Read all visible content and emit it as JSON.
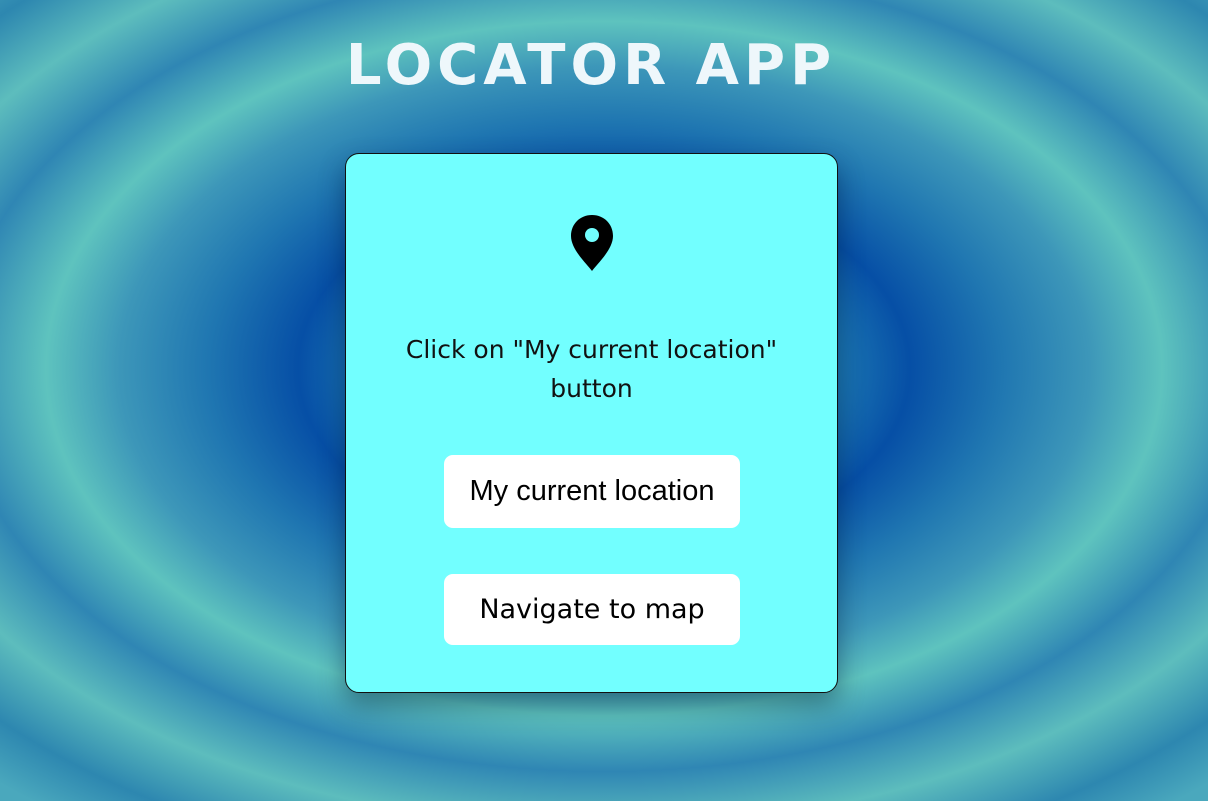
{
  "header": {
    "title": "LOCATOR APP"
  },
  "card": {
    "icon": "location-pin-icon",
    "prompt": "Click on \"My current location\" button",
    "current_location_label": "My current location",
    "navigate_label": "Navigate to map",
    "background_color": "#72ffff"
  }
}
